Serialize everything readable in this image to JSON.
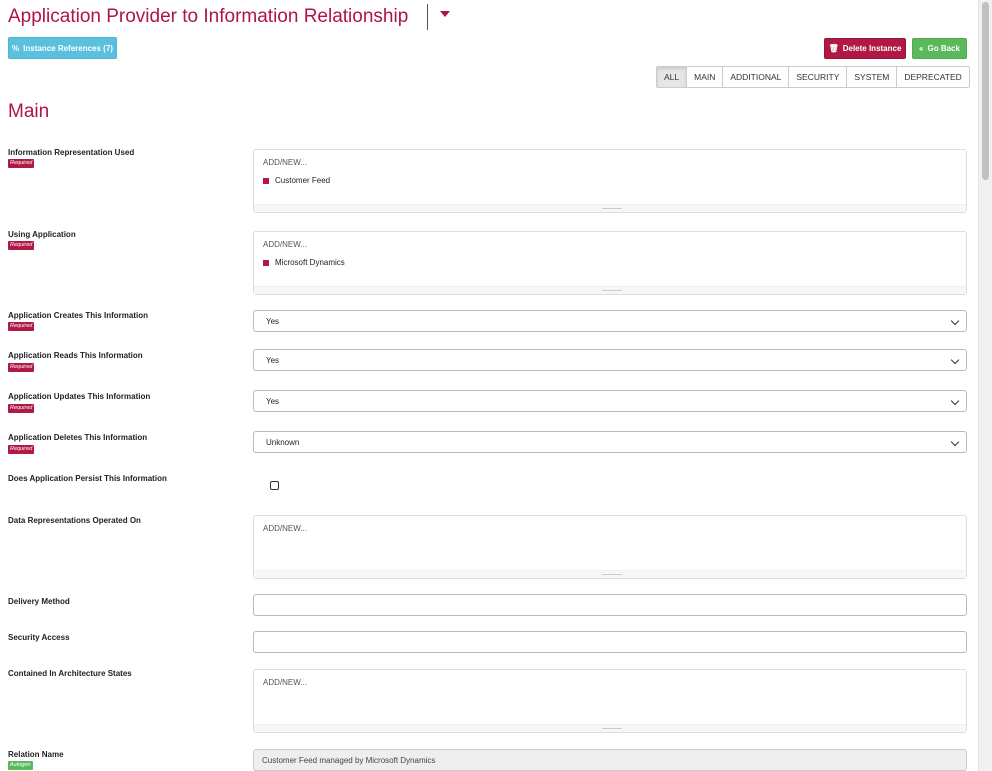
{
  "header": {
    "title": "Application Provider to Information Relationship",
    "instance_refs_label": "Instance References (7)",
    "delete_label": "Delete Instance",
    "back_label": "Go Back"
  },
  "tabs": [
    "ALL",
    "MAIN",
    "ADDITIONAL",
    "SECURITY",
    "SYSTEM",
    "DEPRECATED"
  ],
  "active_tab": "ALL",
  "section_title": "Main",
  "badges": {
    "required": "Required",
    "autogen": "Autogen"
  },
  "fields": {
    "info_rep": {
      "label": "Information Representation Used",
      "add_new": "ADD/NEW...",
      "items": [
        "Customer Feed"
      ]
    },
    "using_app": {
      "label": "Using Application",
      "add_new": "ADD/NEW...",
      "items": [
        "Microsoft Dynamics"
      ]
    },
    "creates": {
      "label": "Application Creates This Information",
      "value": "Yes"
    },
    "reads": {
      "label": "Application Reads This Information",
      "value": "Yes"
    },
    "updates": {
      "label": "Application Updates This Information",
      "value": "Yes"
    },
    "deletes": {
      "label": "Application Deletes This Information",
      "value": "Unknown"
    },
    "persist": {
      "label": "Does Application Persist This Information",
      "checked": false
    },
    "data_reps": {
      "label": "Data Representations Operated On",
      "add_new": "ADD/NEW..."
    },
    "delivery": {
      "label": "Delivery Method",
      "value": ""
    },
    "security": {
      "label": "Security Access",
      "value": ""
    },
    "arch_states": {
      "label": "Contained In Architecture States",
      "add_new": "ADD/NEW..."
    },
    "relation_name": {
      "label": "Relation Name",
      "value": "Customer Feed managed by Microsoft Dynamics"
    }
  },
  "colors": {
    "brand": "#b0134a",
    "info": "#5bc0de",
    "danger": "#b01944",
    "success": "#5cb85c"
  }
}
